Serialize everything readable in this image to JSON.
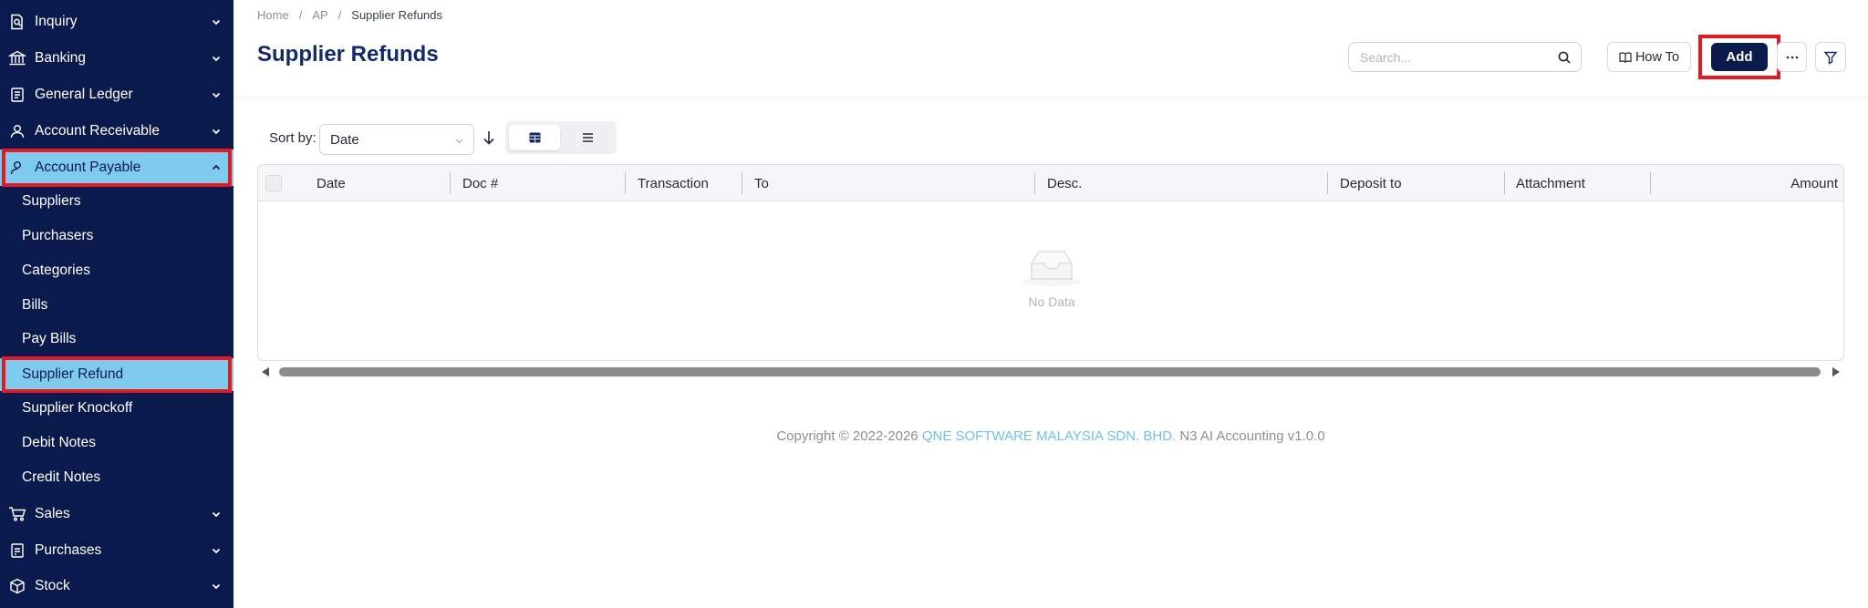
{
  "sidebar": {
    "groups": {
      "inquiry": "Inquiry",
      "banking": "Banking",
      "general_ledger": "General Ledger",
      "account_receivable": "Account Receivable",
      "account_payable": "Account Payable",
      "sales": "Sales",
      "purchases": "Purchases",
      "stock": "Stock"
    },
    "ap_items": [
      "Suppliers",
      "Purchasers",
      "Categories",
      "Bills",
      "Pay Bills",
      "Supplier Refund",
      "Supplier Knockoff",
      "Debit Notes",
      "Credit Notes"
    ],
    "active_group": "Account Payable",
    "active_item": "Supplier Refund"
  },
  "breadcrumb": {
    "home": "Home",
    "section": "AP",
    "current": "Supplier Refunds"
  },
  "page": {
    "title": "Supplier Refunds"
  },
  "toolbar": {
    "search_placeholder": "Search...",
    "how_to_label": "How To",
    "add_label": "Add",
    "more_label": "···"
  },
  "list": {
    "sort_label": "Sort by:",
    "sort_value": "Date",
    "columns": [
      "Date",
      "Doc #",
      "Transaction",
      "To",
      "Desc.",
      "Deposit to",
      "Attachment",
      "Amount"
    ],
    "empty_text": "No Data"
  },
  "footer": {
    "prefix": "Copyright © 2022-2026 ",
    "company": "QNE SOFTWARE MALAYSIA SDN. BHD.",
    "suffix": " N3 AI Accounting v1.0.0"
  },
  "colors": {
    "sidebar_bg": "#0b1a4d",
    "active_bg": "#7ecbee",
    "highlight": "#e21b23",
    "title": "#13296b",
    "brand_link": "#6fc3ea"
  }
}
